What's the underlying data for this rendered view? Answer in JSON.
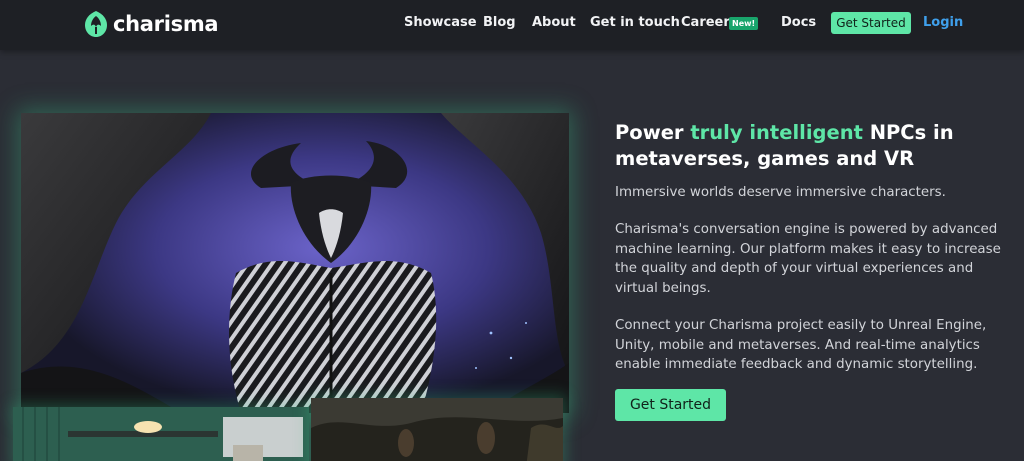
{
  "nav": {
    "brand": "charisma",
    "links": [
      "Showcase",
      "Blog",
      "About",
      "Get in touch",
      "Careers",
      "Docs"
    ],
    "new_badge": "New!",
    "cta": "Get Started",
    "login": "Login"
  },
  "hero": {
    "title_before": "Power ",
    "title_accent": "truly intelligent",
    "title_after": " NPCs in metaverses, games and VR",
    "para1": "Immersive worlds deserve immersive characters.",
    "para2": "Charisma's conversation engine is powered by advanced machine learning. Our platform makes it easy to increase the quality and depth of your virtual experiences and virtual beings.",
    "para3": "Connect your Charisma project easily to Unreal Engine, Unity, mobile and metaverses. And real-time analytics enable immediate feedback and dynamic storytelling.",
    "cta": "Get Started"
  },
  "colors": {
    "accent": "#5ee6a7",
    "nav_bg": "#1e2025",
    "page_bg": "#2b2d35",
    "login": "#3fa0ec",
    "badge": "#19a56c"
  }
}
